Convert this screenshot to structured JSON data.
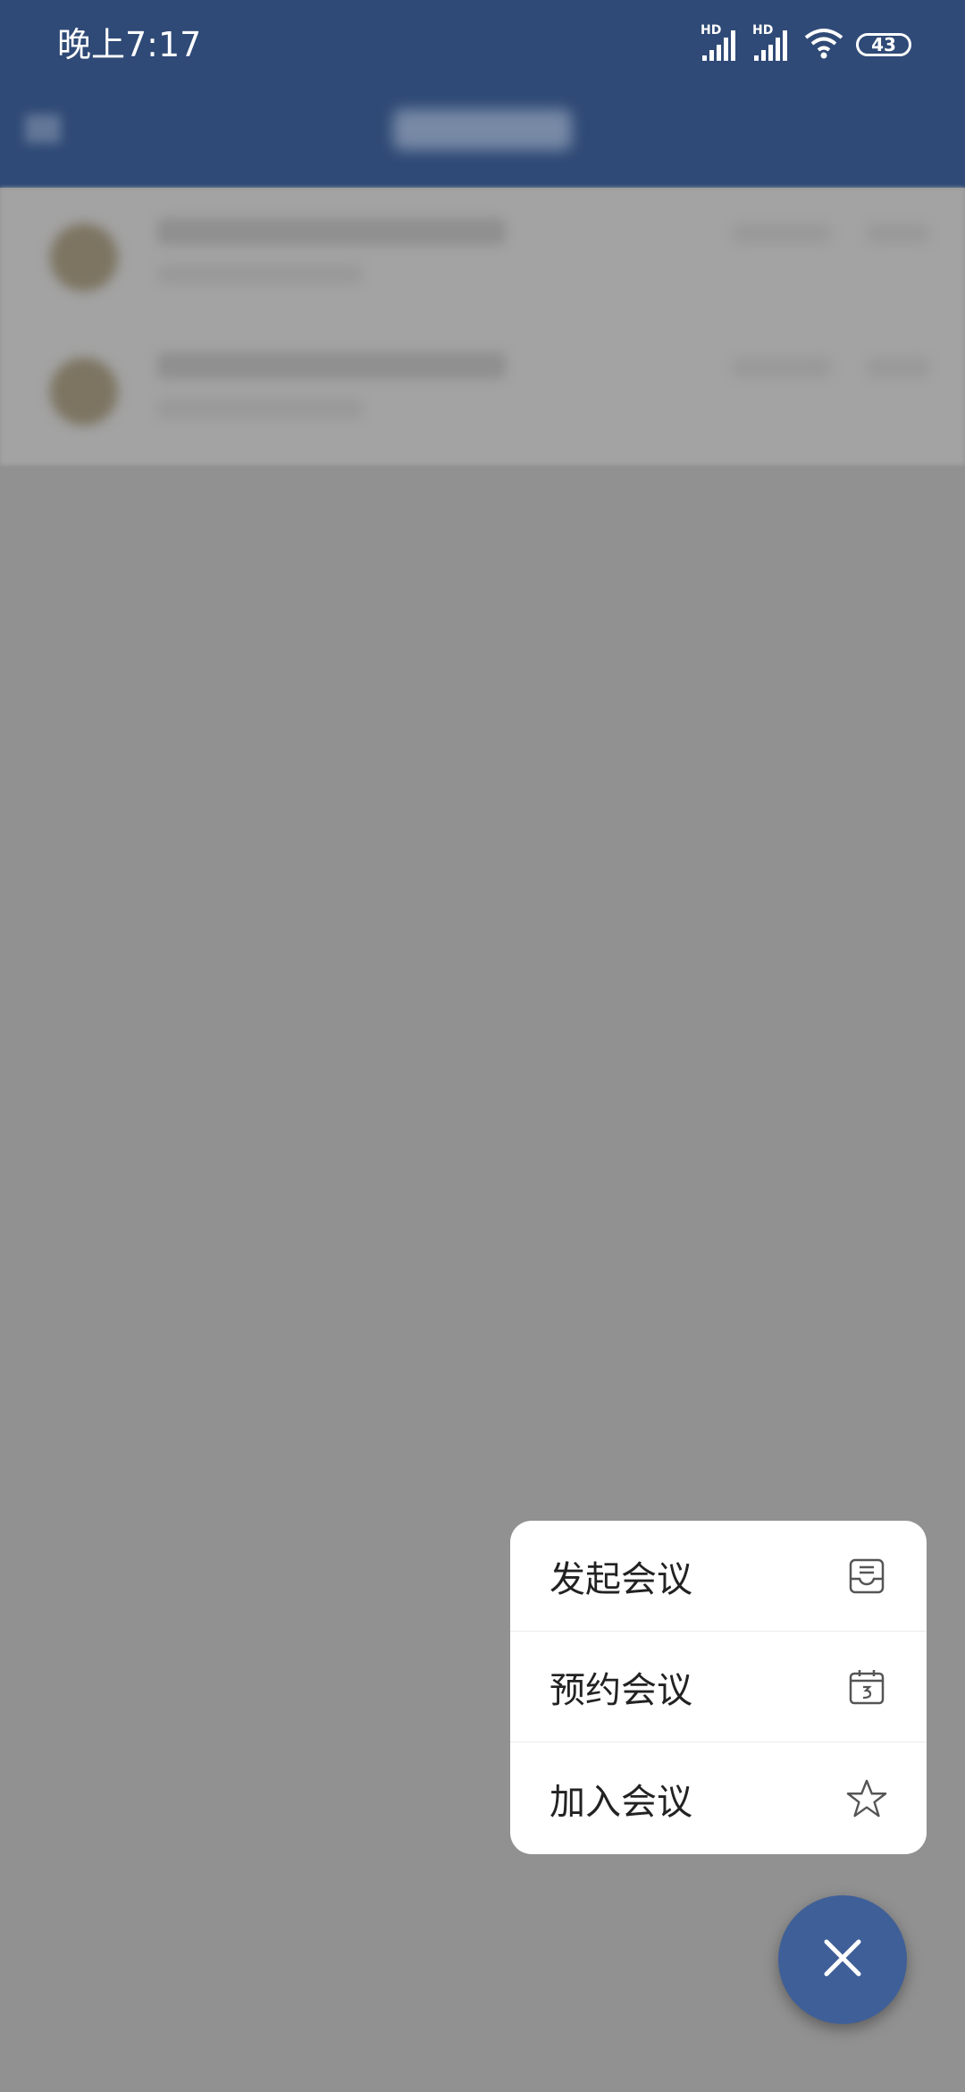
{
  "status_bar": {
    "time": "晚上7:17",
    "signal1_label": "HD",
    "signal2_label": "HD",
    "battery": "43"
  },
  "menu": {
    "items": [
      {
        "label": "发起会议",
        "icon": "inbox-tray-icon"
      },
      {
        "label": "预约会议",
        "icon": "calendar-icon"
      },
      {
        "label": "加入会议",
        "icon": "star-icon"
      }
    ]
  },
  "fab": {
    "icon": "close-icon"
  },
  "colors": {
    "primary": "#2f4a76",
    "fab": "#3f5f98",
    "scrim": "#919191",
    "menu_bg": "#ffffff",
    "text": "#222222"
  }
}
